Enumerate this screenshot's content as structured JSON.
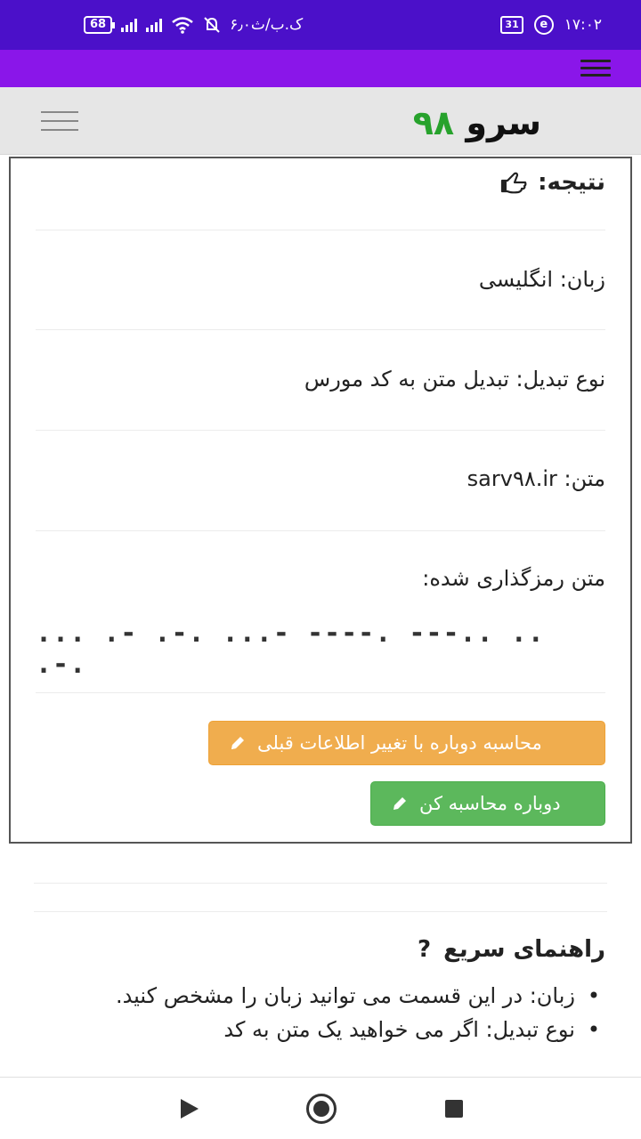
{
  "status_bar": {
    "battery": "68",
    "speed": "۶٫۰ک.ب/ث",
    "calendar": "31",
    "time": "۱۷:۰۲"
  },
  "header": {
    "logo_word": "سرو",
    "logo_number": "۹۸"
  },
  "result": {
    "title": "نتیجه:",
    "language": "زبان: انگلیسی",
    "conversion_type": "نوع تبدیل: تبدیل متن به کد مورس",
    "text": "متن: sarv۹۸.ir",
    "encoded_label": "متن رمزگذاری شده:",
    "morse": "... .- .-. ...- ----. ---.. .. .-.",
    "recalc_prev_button": "محاسبه دوباره با تغییر اطلاعات قبلی",
    "recalc_button": "دوباره محاسبه کن"
  },
  "guide": {
    "title": "راهنمای سریع",
    "items": [
      "زبان: در این قسمت می توانید زبان را مشخص کنید.",
      "نوع تبدیل: اگر می خواهید یک متن به کد"
    ]
  },
  "colors": {
    "status_bar": "#4b10c9",
    "nav_bar": "#8a16e9",
    "logo_green": "#27a22c",
    "warning": "#f0ad4e",
    "success": "#5cb85c"
  }
}
